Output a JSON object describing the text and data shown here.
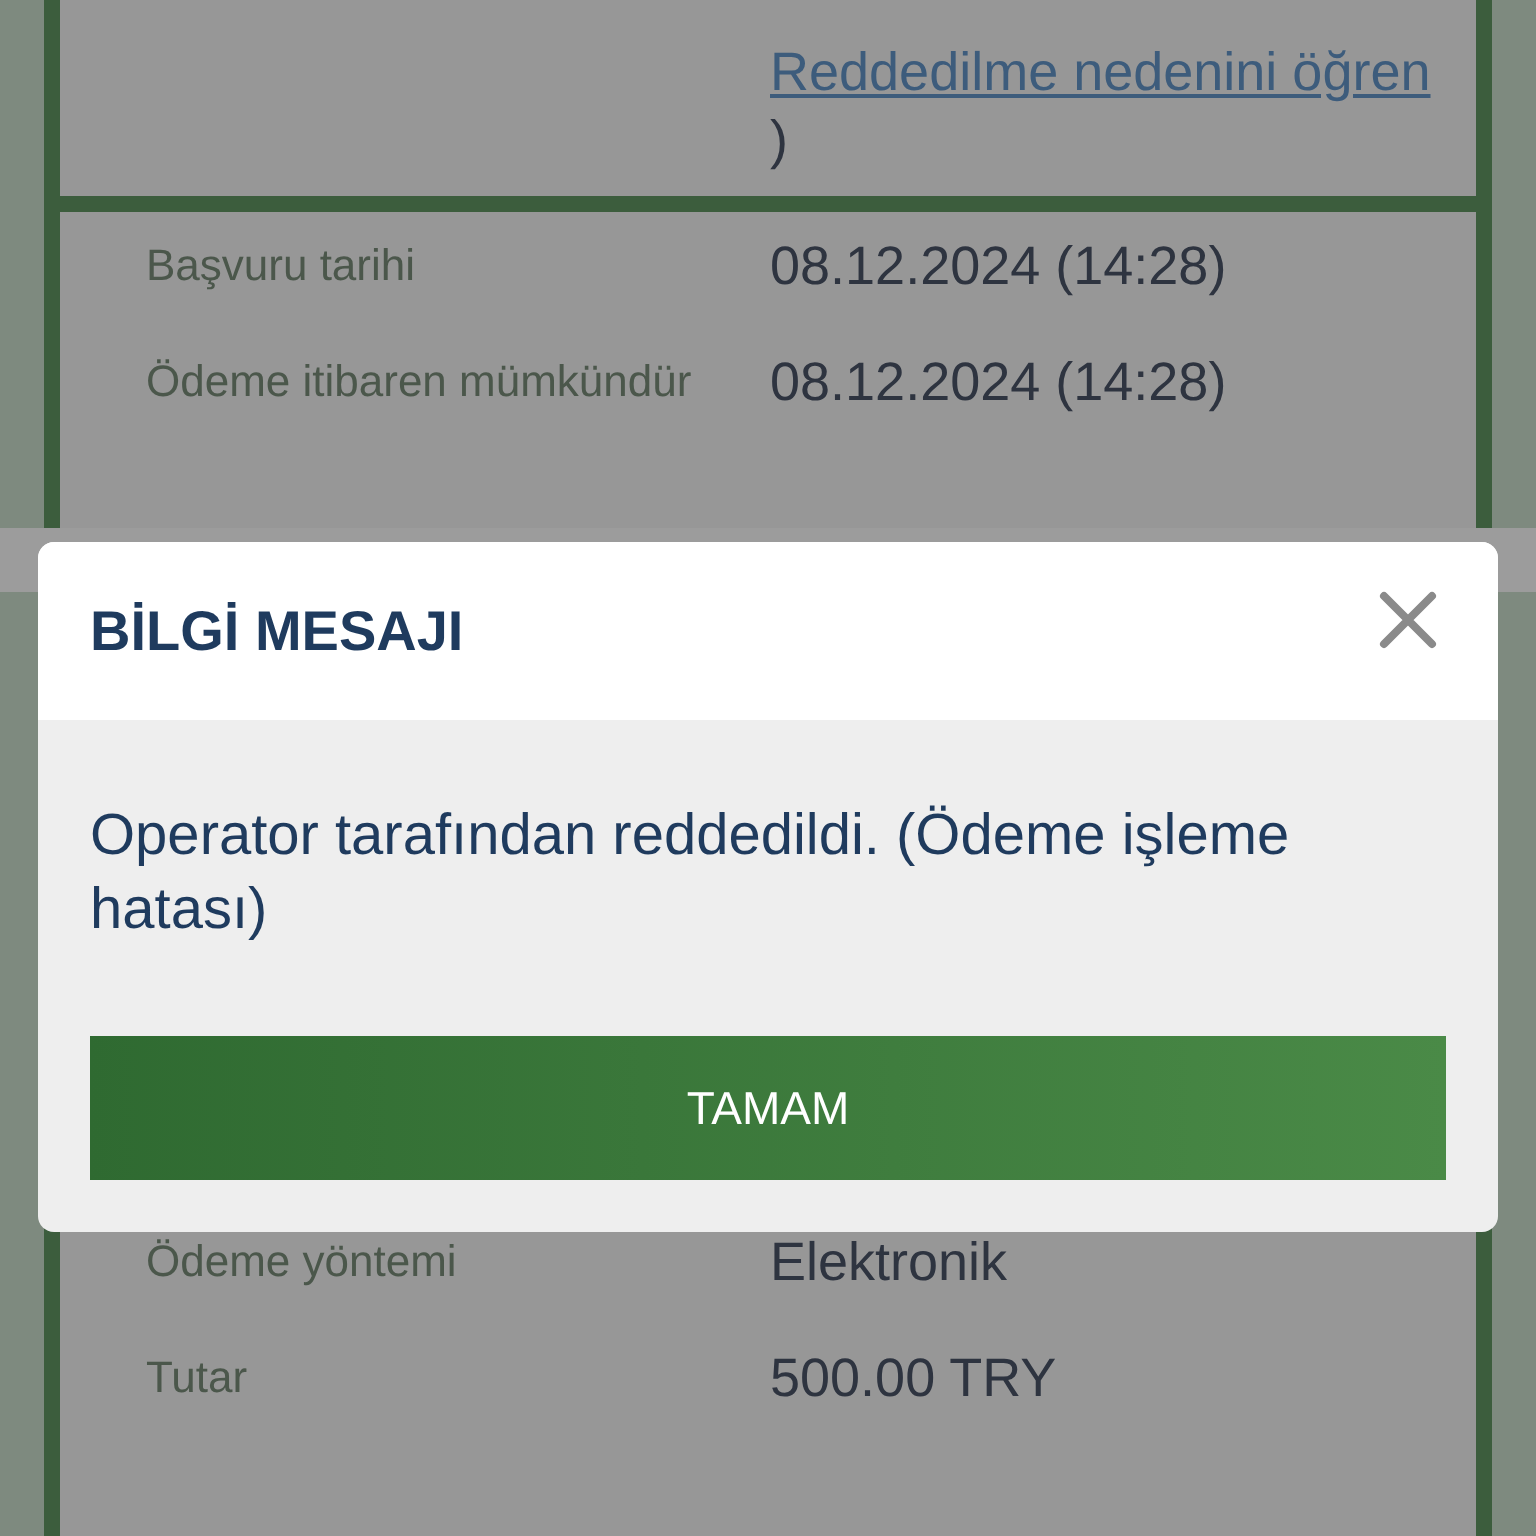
{
  "background": {
    "cards": [
      {
        "rows": [
          {
            "link": "Reddedilme nedenini öğren",
            "value_end": ")"
          }
        ]
      },
      {
        "rows": [
          {
            "label": "Başvuru tarihi",
            "value": "08.12.2024 (14:28)"
          },
          {
            "label": "Ödeme itibaren mümkündür",
            "value": "08.12.2024 (14:28)"
          }
        ]
      },
      {
        "rows": [
          {
            "label": "Ödeme yöntemi",
            "value": "Elektronik"
          },
          {
            "label": "Tutar",
            "value": "500.00 TRY"
          }
        ]
      }
    ]
  },
  "dialog": {
    "title": "BİLGİ MESAJI",
    "message": "Operator tarafından reddedildi. (Ödeme işleme hatası)",
    "button": "TAMAM"
  }
}
